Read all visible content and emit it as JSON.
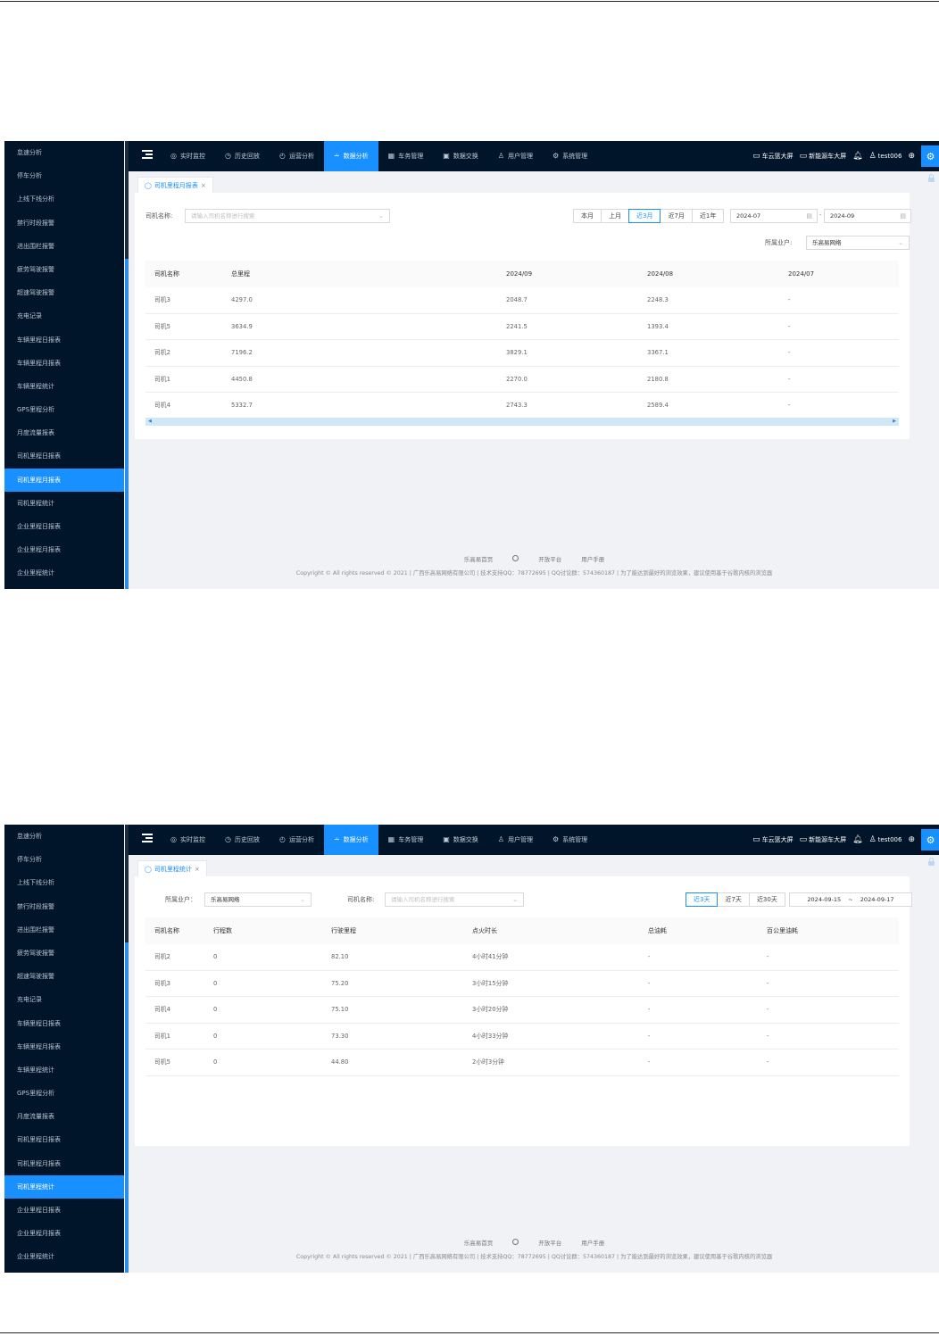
{
  "sidebar_items": [
    "怠速分析",
    "停车分析",
    "上线下线分析",
    "禁行时段报警",
    "进出围栏报警",
    "疲劳驾驶报警",
    "超速驾驶报警",
    "充电记录",
    "车辆里程日报表",
    "车辆里程月报表",
    "车辆里程统计",
    "GPS里程分析",
    "月度流量报表",
    "司机里程日报表",
    "司机里程月报表",
    "司机里程统计",
    "企业里程日报表",
    "企业里程月报表",
    "企业里程统计"
  ],
  "nav": [
    {
      "icon": "◎",
      "label": "实时监控"
    },
    {
      "icon": "◷",
      "label": "历史回放"
    },
    {
      "icon": "◴",
      "label": "运营分析"
    },
    {
      "icon": "⩪",
      "label": "数据分析"
    },
    {
      "icon": "▦",
      "label": "车务管理"
    },
    {
      "icon": "▣",
      "label": "数据交换"
    },
    {
      "icon": "♙",
      "label": "用户管理"
    },
    {
      "icon": "⚙",
      "label": "系统管理"
    }
  ],
  "topbar_right": {
    "screen1_icon": "▭",
    "screen1": "车云篮大屏",
    "screen2_icon": "▭",
    "screen2": "新能源车大屏",
    "bell_icon": "🔔︎",
    "user_icon": "♙",
    "user": "test006",
    "globe_icon": "⊕",
    "settings_icon": "⚙"
  },
  "footer": {
    "links": [
      "乐高易首页",
      "开放平台",
      "用户手册"
    ],
    "copyright": "Copyright © All rights reserved © 2021 | 广西乐高易网络有限公司 | 技术支持QQ：78772695 | QQ讨论群：574360187 | 为了能达到最好的浏览效果，建议使用基于谷歌内核的浏览器"
  },
  "screen1": {
    "active_sidebar": 14,
    "tab_icon": "◯",
    "tab_label": "司机里程月报表",
    "tab_close": "×",
    "driver_label": "司机名称:",
    "driver_placeholder": "请输入司机名称进行搜索",
    "caret": "⌄",
    "quick_ranges": [
      "本月",
      "上月",
      "近3月",
      "近7月",
      "近1年"
    ],
    "active_range": 2,
    "date_from": "2024-07",
    "date_to": "2024-09",
    "date_sep": "-",
    "calendar_icon": "▤",
    "tenant_label": "所属业户:",
    "tenant_value": "乐高易网络",
    "columns": [
      "司机名称",
      "总里程",
      "2024/09",
      "2024/08",
      "2024/07"
    ],
    "rows": [
      [
        "司机3",
        "4297.0",
        "2048.7",
        "2248.3",
        "-"
      ],
      [
        "司机5",
        "3634.9",
        "2241.5",
        "1393.4",
        "-"
      ],
      [
        "司机2",
        "7196.2",
        "3829.1",
        "3367.1",
        "-"
      ],
      [
        "司机1",
        "4450.8",
        "2270.0",
        "2180.8",
        "-"
      ],
      [
        "司机4",
        "5332.7",
        "2743.3",
        "2589.4",
        "-"
      ]
    ],
    "scroll_left": "◀",
    "scroll_right": "▶"
  },
  "screen2": {
    "active_sidebar": 15,
    "tab_icon": "◯",
    "tab_label": "司机里程统计",
    "tab_close": "×",
    "tenant_label": "所属业户：",
    "tenant_value": "乐高易网络",
    "driver_label": "司机名称:",
    "driver_placeholder": "请输入司机名称进行搜索",
    "caret": "⌄",
    "quick_ranges": [
      "近3天",
      "近7天",
      "近30天"
    ],
    "active_range": 0,
    "date_from": "2024-09-15",
    "date_sep": "~",
    "date_to": "2024-09-17",
    "columns": [
      "司机名称",
      "行程数",
      "行驶里程",
      "点火时长",
      "总油耗",
      "百公里油耗"
    ],
    "rows": [
      [
        "司机2",
        "0",
        "82.10",
        "4小时41分钟",
        "-",
        "-"
      ],
      [
        "司机3",
        "0",
        "75.20",
        "3小时15分钟",
        "-",
        "-"
      ],
      [
        "司机4",
        "0",
        "75.10",
        "3小时20分钟",
        "-",
        "-"
      ],
      [
        "司机1",
        "0",
        "73.30",
        "4小时33分钟",
        "-",
        "-"
      ],
      [
        "司机5",
        "0",
        "44.80",
        "2小时3分钟",
        "-",
        "-"
      ]
    ]
  }
}
